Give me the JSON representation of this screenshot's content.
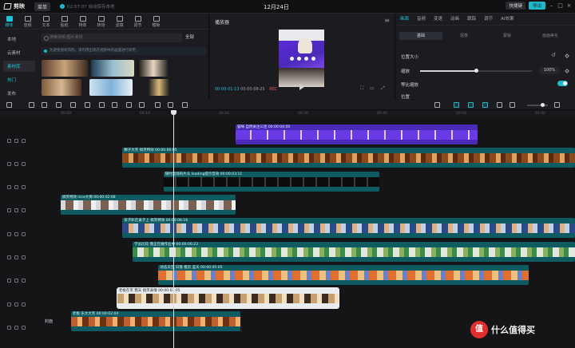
{
  "app": {
    "logo_text": "剪映",
    "menu_label": "菜单",
    "autosave_text": "02:07:07 自动保存本地",
    "project_title": "12月24日",
    "shortcut_label": "快捷键",
    "export_label": "导出"
  },
  "media_tools": [
    "媒体",
    "音频",
    "文本",
    "贴纸",
    "特效",
    "转场",
    "滤镜",
    "调节",
    "模板"
  ],
  "media_side": [
    "本地",
    "云素材",
    "素材库",
    "热门",
    "发布"
  ],
  "media_search_placeholder": "搜索视频/图片素材",
  "media_all_label": "全部",
  "media_notice": "为避免侵权风险，请勿用出现在视频中的画面进行商用",
  "player": {
    "title": "播放器",
    "current_time": "00:00:01:13",
    "total_time": "00:00:08:25",
    "rec_label": "REC"
  },
  "inspector": {
    "tabs": [
      "画面",
      "音频",
      "变速",
      "动画",
      "跟踪",
      "调节",
      "AI效果"
    ],
    "subtabs": [
      "基础",
      "抠像",
      "蒙版",
      "画面美化"
    ],
    "position_size_label": "位置大小",
    "scale_label": "缩放",
    "scale_value": "100%",
    "scale_fraction": 0.5,
    "uniform_scale_label": "等比缩放",
    "position_label": "位置"
  },
  "ruler_ticks": [
    "00:00",
    "00:10",
    "00:20",
    "00:30",
    "00:40",
    "00:50",
    "01:00"
  ],
  "clips": [
    {
      "label": "猫咪 自然关注三连 00:00:04:00",
      "start": 0.34,
      "end": 0.81
    },
    {
      "label": "狮子大笑 搞笑特效 00:00:06:05",
      "start": 0.12,
      "end": 1.0
    },
    {
      "label": "随时出现的片头 loading提示音效 00:00:03:11",
      "start": 0.2,
      "end": 0.62
    },
    {
      "label": "搞笑特效 nice大拇 00:00:02:08",
      "start": 0.0,
      "end": 0.34
    },
    {
      "label": "孩子趴在桌子上 搞笑特效 00:00:06:16",
      "start": 0.12,
      "end": 1.0
    },
    {
      "label": "学员比较 我正在做作业中 00:00:06:23",
      "start": 0.14,
      "end": 1.0
    },
    {
      "label": "动态天空 日落 橙云 蓝天 00:00:05:05",
      "start": 0.19,
      "end": 0.91
    },
    {
      "label": "老板在笑 我天 搞笑表情 00:00:03:05",
      "start": 0.11,
      "end": 0.54
    },
    {
      "label": "老板 乐大大笑 00:00:02:04",
      "start": 0.02,
      "end": 0.35
    }
  ],
  "timeline_cover_label": "封面",
  "watermark": {
    "badge": "值",
    "text": "什么值得买"
  },
  "colors": {
    "accent": "#1fb8c9",
    "clip_teal": "#0e5b61",
    "clip_purple": "#5a2bd9"
  }
}
